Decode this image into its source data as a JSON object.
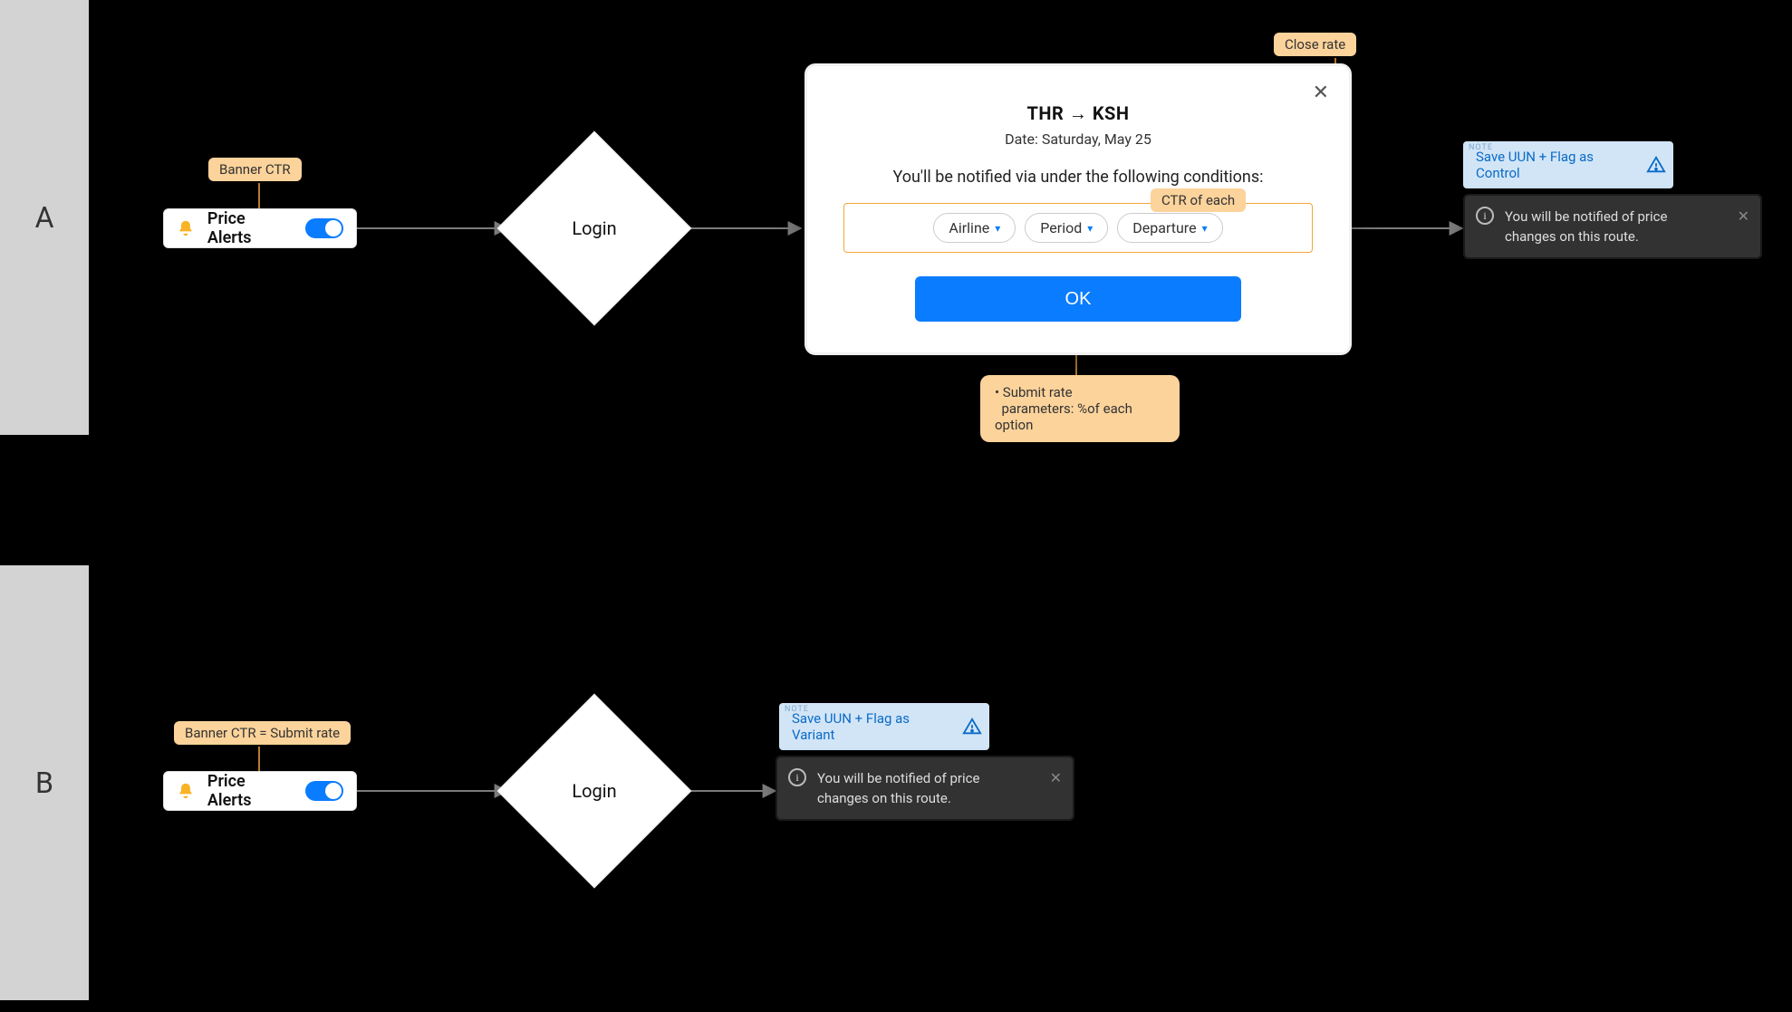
{
  "lanes": {
    "a": "A",
    "b": "B"
  },
  "banner": {
    "label": "Price Alerts"
  },
  "decision": {
    "label": "Login"
  },
  "modal": {
    "route_from": "THR",
    "route_to": "KSH",
    "date_line": "Date: Saturday, May 25",
    "subtitle": "You'll be notified via under the following conditions:",
    "dd1": "Airline",
    "dd2": "Period",
    "dd3": "Departure",
    "ok": "OK"
  },
  "ann": {
    "banner_ctr": "Banner CTR",
    "close_rate": "Close rate",
    "ctr_each": "CTR of each",
    "submit_rate": "Submit rate",
    "submit_params": "parameters: %of each option",
    "banner_ctr_eq": "Banner CTR = Submit rate"
  },
  "notes": {
    "tag": "NOTE",
    "control": "Save UUN + Flag as Control",
    "variant": "Save UUN + Flag as Variant"
  },
  "toast": {
    "text": "You will be notified of price changes on this route."
  }
}
